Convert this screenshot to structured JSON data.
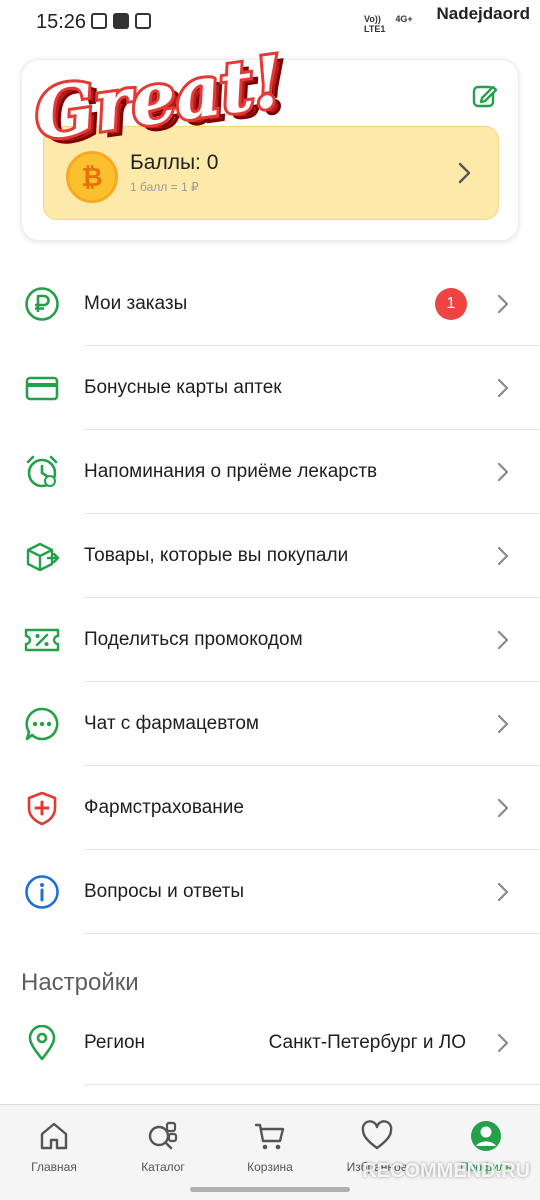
{
  "status_bar": {
    "time": "15:26",
    "network_label_1": "Vo))\nLTE1",
    "network_label_2": "4G+",
    "username": "Nadejdaord"
  },
  "bonus_card": {
    "points_title": "Баллы: 0",
    "points_rate": "1 балл = 1 ₽",
    "coin_symbol": "₿"
  },
  "sticker": {
    "text": "Great!"
  },
  "menu": [
    {
      "label": "Мои заказы",
      "icon": "ruble-icon",
      "badge": "1"
    },
    {
      "label": "Бонусные карты аптек",
      "icon": "card-icon"
    },
    {
      "label": "Напоминания о приёме лекарств",
      "icon": "alarm-clock-icon"
    },
    {
      "label": "Товары, которые вы покупали",
      "icon": "box-arrow-icon"
    },
    {
      "label": "Поделиться промокодом",
      "icon": "percent-ticket-icon"
    },
    {
      "label": "Чат с фармацевтом",
      "icon": "chat-bubble-icon"
    },
    {
      "label": "Фармстрахование",
      "icon": "shield-cross-icon"
    },
    {
      "label": "Вопросы и ответы",
      "icon": "info-icon"
    }
  ],
  "settings": {
    "title": "Настройки",
    "region_label": "Регион",
    "region_value": "Санкт-Петербург и ЛО"
  },
  "bottom_nav": [
    {
      "label": "Главная",
      "icon": "home-icon"
    },
    {
      "label": "Каталог",
      "icon": "catalog-search-icon"
    },
    {
      "label": "Корзина",
      "icon": "cart-icon"
    },
    {
      "label": "Избранное",
      "icon": "heart-icon"
    },
    {
      "label": "Профиль",
      "icon": "profile-icon",
      "active": true
    }
  ],
  "watermark": "RECOMMEND.RU",
  "colors": {
    "accent": "#24a04a",
    "badge": "#ef4444",
    "points_bg": "#fde9a9"
  }
}
